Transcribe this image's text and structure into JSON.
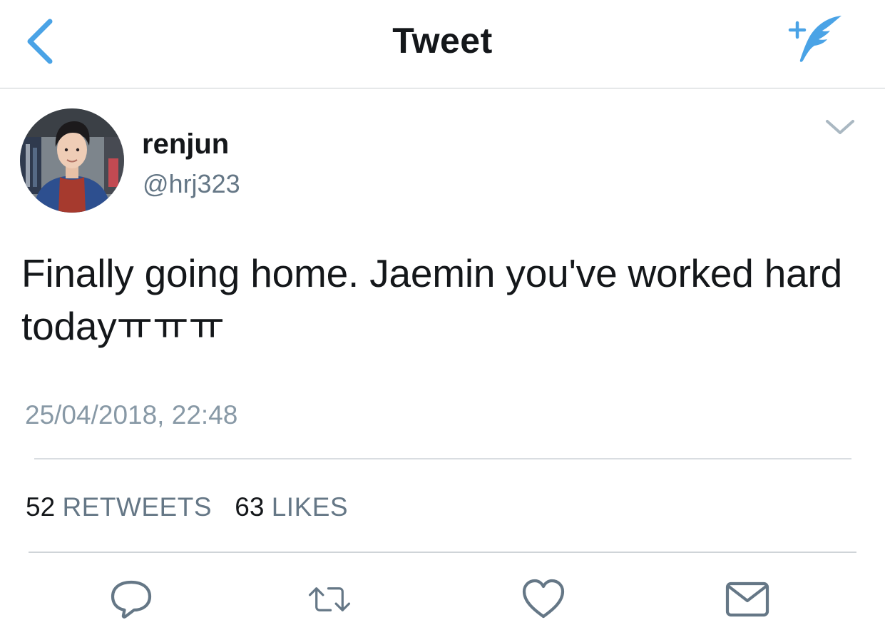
{
  "header": {
    "title": "Tweet",
    "back_icon": "chevron-left-icon",
    "compose_icon": "compose-tweet-icon"
  },
  "author": {
    "display_name": "renjun",
    "handle": "@hrj323",
    "avatar_icon": "avatar"
  },
  "tweet": {
    "text": "Finally going home. Jaemin you've worked hard todayㅠㅠㅠ",
    "timestamp": "25/04/2018, 22:48"
  },
  "stats": {
    "retweets_count": "52",
    "retweets_label": "RETWEETS",
    "likes_count": "63",
    "likes_label": "LIKES"
  },
  "actions": {
    "reply_icon": "reply-icon",
    "retweet_icon": "retweet-icon",
    "like_icon": "heart-icon",
    "share_icon": "mail-icon"
  },
  "colors": {
    "accent": "#4aa3e6",
    "text_primary": "#14171a",
    "text_secondary": "#657786",
    "divider": "#d9dde1"
  }
}
